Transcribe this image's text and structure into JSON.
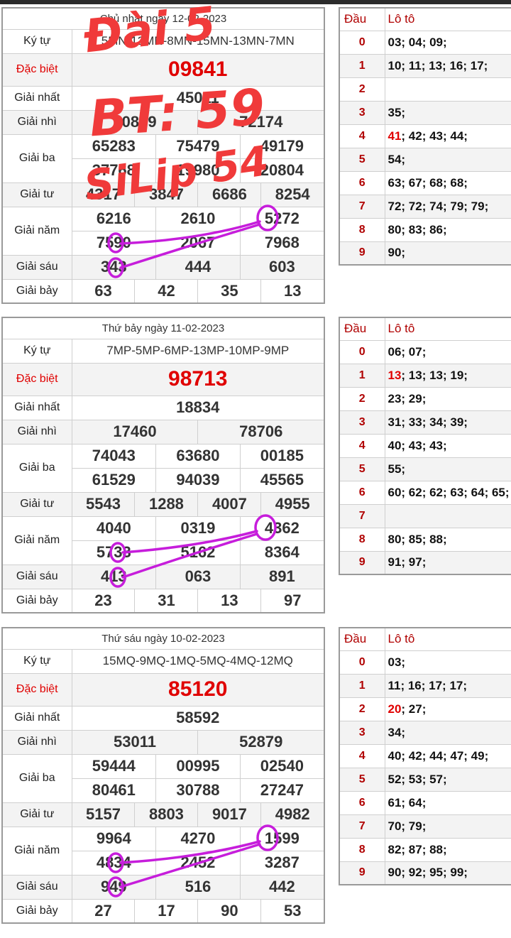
{
  "labels": {
    "kytu": "Ký tự",
    "dacbiet": "Đặc biệt",
    "g1": "Giải nhất",
    "g2": "Giải nhì",
    "g3": "Giải ba",
    "g4": "Giải tư",
    "g5": "Giải năm",
    "g6": "Giải sáu",
    "g7": "Giải bảy",
    "dau": "Đầu",
    "loto": "Lô tô"
  },
  "annotation": {
    "line1": "Đài 5",
    "line2": "BT: 59",
    "line3": "SiLip 54",
    "ink_color": "#f03a3a",
    "circle_color": "#c61ddb"
  },
  "draws": [
    {
      "header": "Chủ nhật ngày 12-02-2023",
      "kytu": "5MN-12MN-8MN-15MN-13MN-7MN",
      "db": "09841",
      "g1": [
        "45011"
      ],
      "g2": [
        "90809",
        "72174"
      ],
      "g3a": [
        "65283",
        "75479",
        "49179"
      ],
      "g3b": [
        "37768",
        "19980",
        "20804"
      ],
      "g4": [
        "4317",
        "3847",
        "6686",
        "8254"
      ],
      "g5a": [
        "6216",
        "2610",
        "5272"
      ],
      "g5b": [
        "7590",
        "2067",
        "7968"
      ],
      "g6": [
        "343",
        "444",
        "603"
      ],
      "g7": [
        "63",
        "42",
        "35",
        "13"
      ],
      "loto": [
        {
          "d": "0",
          "v": "03; 04; 09;"
        },
        {
          "d": "1",
          "v": "10; 11; 13; 16; 17;"
        },
        {
          "d": "2",
          "v": ""
        },
        {
          "d": "3",
          "v": "35;"
        },
        {
          "d": "4",
          "h": "41",
          "v": "; 42; 43; 44;"
        },
        {
          "d": "5",
          "v": "54;"
        },
        {
          "d": "6",
          "v": "63; 67; 68; 68;"
        },
        {
          "d": "7",
          "v": "72; 72; 74; 79; 79;"
        },
        {
          "d": "8",
          "v": "80; 83; 86;"
        },
        {
          "d": "9",
          "v": "90;"
        }
      ]
    },
    {
      "header": "Thứ bảy ngày 11-02-2023",
      "kytu": "7MP-5MP-6MP-13MP-10MP-9MP",
      "db": "98713",
      "g1": [
        "18834"
      ],
      "g2": [
        "17460",
        "78706"
      ],
      "g3a": [
        "74043",
        "63680",
        "00185"
      ],
      "g3b": [
        "61529",
        "94039",
        "45565"
      ],
      "g4": [
        "5543",
        "1288",
        "4007",
        "4955"
      ],
      "g5a": [
        "4040",
        "0319",
        "4362"
      ],
      "g5b": [
        "5733",
        "5162",
        "8364"
      ],
      "g6": [
        "413",
        "063",
        "891"
      ],
      "g7": [
        "23",
        "31",
        "13",
        "97"
      ],
      "loto": [
        {
          "d": "0",
          "v": "06; 07;"
        },
        {
          "d": "1",
          "h": "13",
          "v": "; 13; 13; 19;"
        },
        {
          "d": "2",
          "v": "23; 29;"
        },
        {
          "d": "3",
          "v": "31; 33; 34; 39;"
        },
        {
          "d": "4",
          "v": "40; 43; 43;"
        },
        {
          "d": "5",
          "v": "55;"
        },
        {
          "d": "6",
          "v": "60; 62; 62; 63; 64; 65;"
        },
        {
          "d": "7",
          "v": ""
        },
        {
          "d": "8",
          "v": "80; 85; 88;"
        },
        {
          "d": "9",
          "v": "91; 97;"
        }
      ]
    },
    {
      "header": "Thứ sáu ngày 10-02-2023",
      "kytu": "15MQ-9MQ-1MQ-5MQ-4MQ-12MQ",
      "db": "85120",
      "g1": [
        "58592"
      ],
      "g2": [
        "53011",
        "52879"
      ],
      "g3a": [
        "59444",
        "00995",
        "02540"
      ],
      "g3b": [
        "80461",
        "30788",
        "27247"
      ],
      "g4": [
        "5157",
        "8803",
        "9017",
        "4982"
      ],
      "g5a": [
        "9964",
        "4270",
        "1599"
      ],
      "g5b": [
        "4834",
        "2452",
        "3287"
      ],
      "g6": [
        "949",
        "516",
        "442"
      ],
      "g7": [
        "27",
        "17",
        "90",
        "53"
      ],
      "loto": [
        {
          "d": "0",
          "v": "03;"
        },
        {
          "d": "1",
          "v": "11; 16; 17; 17;"
        },
        {
          "d": "2",
          "h": "20",
          "v": "; 27;"
        },
        {
          "d": "3",
          "v": "34;"
        },
        {
          "d": "4",
          "v": "40; 42; 44; 47; 49;"
        },
        {
          "d": "5",
          "v": "52; 53; 57;"
        },
        {
          "d": "6",
          "v": "61; 64;"
        },
        {
          "d": "7",
          "v": "70; 79;"
        },
        {
          "d": "8",
          "v": "82; 87; 88;"
        },
        {
          "d": "9",
          "v": "90; 92; 95; 99;"
        }
      ]
    }
  ]
}
